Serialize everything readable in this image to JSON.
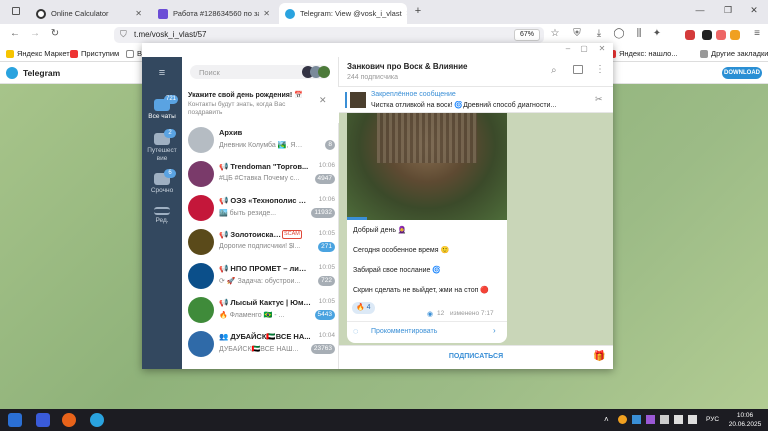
{
  "browser": {
    "tabs": [
      {
        "title": "Online Calculator"
      },
      {
        "title": "Работа #128634560 по заказу"
      },
      {
        "title": "Telegram: View @vosk_i_vlast"
      }
    ],
    "new_tab_label": "+",
    "url": "t.me/vosk_i_vlast/57",
    "zoom": "67%",
    "bookmarks": [
      "Яндекс Маркет",
      "Приступим",
      "Во"
    ],
    "bookmarks_right": [
      "Яндекс: нашло...",
      "Другие закладки"
    ]
  },
  "tg_web": {
    "title": "Telegram",
    "download_label": "DOWNLOAD"
  },
  "app": {
    "rail": [
      {
        "label": "Все чаты",
        "badge": "721"
      },
      {
        "label": "Путешест вие",
        "badge": "2"
      },
      {
        "label": "Срочно",
        "badge": "6"
      },
      {
        "label": "Ред.",
        "badge": ""
      }
    ],
    "search_placeholder": "Поиск",
    "birthday": {
      "title": "Укажите свой день рождения! 📅",
      "text": "Контакты будут знать, когда Вас поздравить"
    },
    "chats": [
      {
        "name": "Архив",
        "msg": "Дневник Колумба 🏞️, Ян...",
        "time": "",
        "badge": "8",
        "color": "#b5bcc3",
        "badge_blue": false
      },
      {
        "name": "📢 Trendoman \"Торгов...",
        "msg": "#ЦБ #Ставка Почему с...",
        "time": "10:06",
        "badge": "4947",
        "color": "#7a3a6a",
        "badge_blue": false
      },
      {
        "name": "📢 ОЭЗ «Технополис М...",
        "msg": "🏙️ быть резиде...",
        "time": "10:06",
        "badge": "11932",
        "color": "#c4173a",
        "badge_blue": false
      },
      {
        "name": "📢 Золотоискатель",
        "msg": "Дорогие подписчики! $l...",
        "time": "10:05",
        "badge": "271",
        "color": "#5a4a1a",
        "badge_blue": true
      },
      {
        "name": "📢 НПО ПРОМЕТ – лиде...",
        "msg": "⟳ 🚀 Задача: обустрои...",
        "time": "10:05",
        "badge": "722",
        "color": "#0b4f8a",
        "badge_blue": false
      },
      {
        "name": "📢 Лысый Кактус | Юмор",
        "msg": "🔥 Фламенго 🇧🇷 - ...",
        "time": "10:05",
        "badge": "5443",
        "color": "#3f8b3a",
        "badge_blue": true
      },
      {
        "name": "👥 ДУБАЙСК🇦🇪ВСЕ НА...",
        "msg": "ДУБАЙСК🇦🇪ВСЕ НАШ...",
        "time": "10:04",
        "badge": "23763",
        "color": "#2f6aa8",
        "badge_blue": false
      }
    ],
    "scam_label": "SCAM",
    "channel": {
      "name": "Занкович про Воск & Влияние",
      "subs": "244 подписчика"
    },
    "pinned": {
      "title": "Закреплённое сообщение",
      "text": "Чистка отливкой на воск! 🌀Древний способ диагности..."
    },
    "message": {
      "lines": [
        "Добрый день 🧕",
        "Сегодня особенное время 🙂",
        "Забирай свое послание 🌀",
        "Скрин сделать не выйдет, жми на стоп 🔴"
      ],
      "reaction": "🔥 4",
      "views": "12",
      "edited": "изменено 7:17",
      "comment_label": "Прокомментировать"
    },
    "subscribe_label": "ПОДПИСАТЬСЯ"
  },
  "taskbar": {
    "lang": "РУС",
    "time": "10:06",
    "date": "20.06.2025"
  }
}
